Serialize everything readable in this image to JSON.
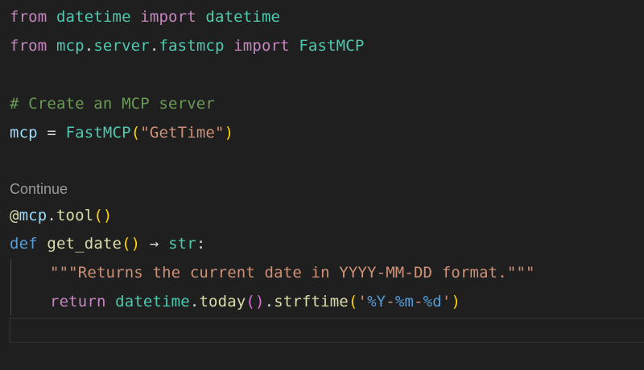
{
  "code": {
    "line1": {
      "from": "from",
      "module": "datetime",
      "import": "import",
      "name": "datetime"
    },
    "line2": {
      "from": "from",
      "module_a": "mcp",
      "dot1": ".",
      "module_b": "server",
      "dot2": ".",
      "module_c": "fastmcp",
      "import": "import",
      "name": "FastMCP"
    },
    "line4": {
      "comment": "# Create an MCP server"
    },
    "line5": {
      "var": "mcp",
      "eq": " = ",
      "cls": "FastMCP",
      "open": "(",
      "str": "\"GetTime\"",
      "close": ")"
    },
    "codelens": "Continue",
    "line7": {
      "at": "@",
      "obj": "mcp",
      "dot": ".",
      "fn": "tool",
      "parens": "()"
    },
    "line8": {
      "def": "def",
      "fn": "get_date",
      "parens": "()",
      "arrow": " → ",
      "type": "str",
      "colon": ":"
    },
    "line9": {
      "docstring": "\"\"\"Returns the current date in YYYY-MM-DD format.\"\"\""
    },
    "line10": {
      "return": "return",
      "obj": "datetime",
      "dot1": ".",
      "fn1": "today",
      "parens1": "()",
      "dot2": ".",
      "fn2": "strftime",
      "open": "(",
      "str_a": "'",
      "fmt1": "%Y",
      "dash1": "-",
      "fmt2": "%m",
      "dash2": "-",
      "fmt3": "%d",
      "str_b": "'",
      "close": ")"
    }
  }
}
